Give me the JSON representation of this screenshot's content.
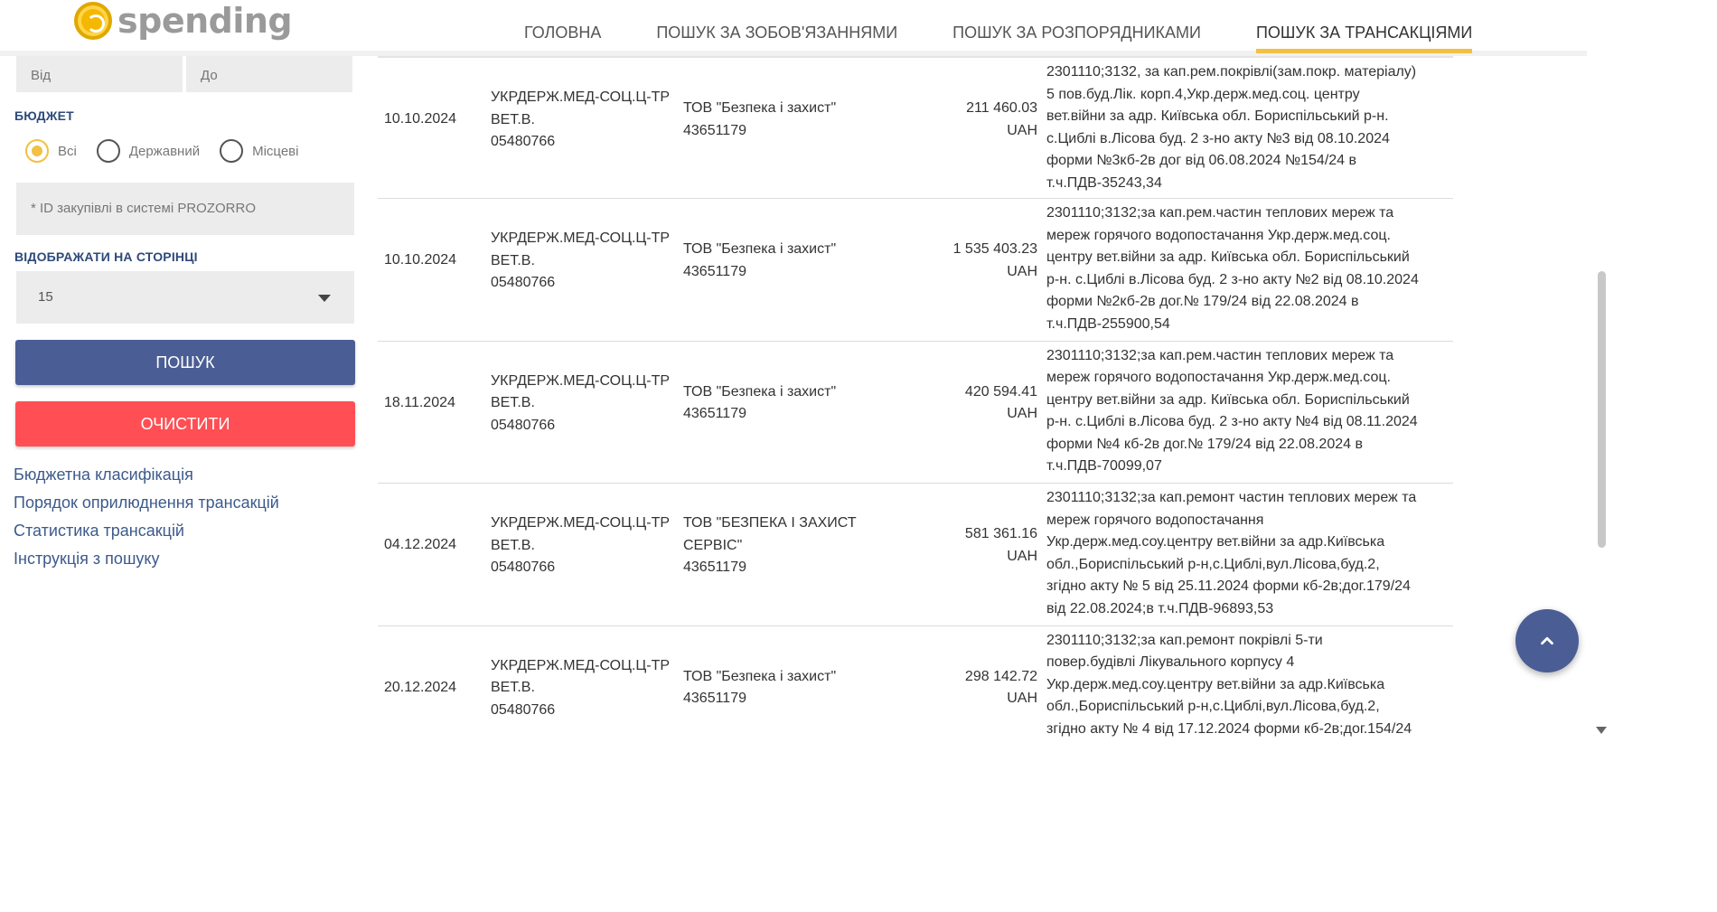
{
  "header": {
    "logo_text": "spending",
    "nav": [
      {
        "label": "ГОЛОВНА",
        "active": false
      },
      {
        "label": "ПОШУК ЗА ЗОБОВ'ЯЗАННЯМИ",
        "active": false
      },
      {
        "label": "ПОШУК ЗА РОЗПОРЯДНИКАМИ",
        "active": false
      },
      {
        "label": "ПОШУК ЗА ТРАНСАКЦІЯМИ",
        "active": true
      }
    ]
  },
  "sidebar": {
    "date_from_placeholder": "Від",
    "date_to_placeholder": "До",
    "budget_heading": "БЮДЖЕТ",
    "budget_options": [
      {
        "label": "Всі",
        "selected": true
      },
      {
        "label": "Державний",
        "selected": false
      },
      {
        "label": "Місцеві",
        "selected": false
      }
    ],
    "prozorro_placeholder": "* ID закупівлі в системі PROZORRO",
    "per_page_heading": "ВІДОБРАЖАТИ НА СТОРІНЦІ",
    "per_page_value": "15",
    "search_button": "ПОШУК",
    "clear_button": "ОЧИСТИТИ",
    "links": [
      "Бюджетна класифікація",
      "Порядок оприлюднення трансакцій",
      "Статистика трансакцій",
      "Інструкція з пошуку"
    ]
  },
  "rows": [
    {
      "date": "10.10.2024",
      "payer": [
        "УКРДЕРЖ.МЕД-СОЦ.Ц-ТР",
        "ВЕТ.В.",
        "05480766"
      ],
      "receiver": [
        "ТОВ \"Безпека і захист\"",
        "43651179"
      ],
      "amount": "211 460.03",
      "currency": "UAH",
      "description": [
        "2301110;3132, за кап.рем.покрівлі(зам.покр. матеріалу)",
        "5 пов.буд.Лік. корп.4,Укр.держ.мед.соц. центру",
        "вет.війни за адр. Київська обл. Бориспільський р-н.",
        "с.Циблі в.Лісова буд. 2 з-но акту №3 від 08.10.2024",
        "форми №3кб-2в дог від 06.08.2024 №154/24 в",
        "т.ч.ПДВ-35243,34"
      ]
    },
    {
      "date": "10.10.2024",
      "payer": [
        "УКРДЕРЖ.МЕД-СОЦ.Ц-ТР",
        "ВЕТ.В.",
        "05480766"
      ],
      "receiver": [
        "ТОВ \"Безпека і захист\"",
        "43651179"
      ],
      "amount": "1 535 403.23",
      "currency": "UAH",
      "description": [
        "2301110;3132;за кап.рем.частин теплових мереж та",
        "мереж горячого водопостачання Укр.держ.мед.соц.",
        "центру вет.війни за адр. Київська обл. Бориспільський",
        "р-н. с.Циблі в.Лісова буд. 2 з-но акту №2 від 08.10.2024",
        "форми №2кб-2в дог.№ 179/24 від 22.08.2024 в",
        "т.ч.ПДВ-255900,54"
      ]
    },
    {
      "date": "18.11.2024",
      "payer": [
        "УКРДЕРЖ.МЕД-СОЦ.Ц-ТР",
        "ВЕТ.В.",
        "05480766"
      ],
      "receiver": [
        "ТОВ \"Безпека і захист\"",
        "43651179"
      ],
      "amount": "420 594.41",
      "currency": "UAH",
      "description": [
        "2301110;3132;за кап.рем.частин теплових мереж та",
        "мереж горячого водопостачання Укр.держ.мед.соц.",
        "центру вет.війни за адр. Київська обл. Бориспільський",
        "р-н. с.Циблі в.Лісова буд. 2 з-но акту №4 від 08.11.2024",
        "форми №4 кб-2в дог.№ 179/24 від 22.08.2024 в",
        "т.ч.ПДВ-70099,07"
      ]
    },
    {
      "date": "04.12.2024",
      "payer": [
        "УКРДЕРЖ.МЕД-СОЦ.Ц-ТР",
        "ВЕТ.В.",
        "05480766"
      ],
      "receiver": [
        "ТОВ \"БЕЗПЕКА І ЗАХИСТ",
        "СЕРВІС\"",
        "43651179"
      ],
      "amount": "581 361.16",
      "currency": "UAH",
      "description": [
        "2301110;3132;за кап.ремонт частин теплових мереж та",
        "мереж горячого водопостачання",
        "Укр.держ.мед.соу.центру вет.війни за адр.Київська",
        "обл.,Бориспільський р-н,с.Циблі,вул.Лісова,буд.2,",
        "згідно акту № 5 від 25.11.2024 форми кб-2в;дог.179/24",
        "від 22.08.2024;в т.ч.ПДВ-96893,53"
      ]
    },
    {
      "date": "20.12.2024",
      "payer": [
        "УКРДЕРЖ.МЕД-СОЦ.Ц-ТР",
        "ВЕТ.В.",
        "05480766"
      ],
      "receiver": [
        "ТОВ \"Безпека і захист\"",
        "43651179"
      ],
      "amount": "298 142.72",
      "currency": "UAH",
      "description": [
        "2301110;3132;за кап.ремонт покрівлі 5-ти",
        "повер.будівлі Лікувального корпусу 4",
        "Укр.держ.мед.соу.центру вет.війни за адр.Київська",
        "обл.,Бориспільський р-н,с.Циблі,вул.Лісова,буд.2,",
        "згідно акту № 4 від 17.12.2024 форми кб-2в;дог.154/24"
      ]
    }
  ],
  "colors": {
    "accent": "#f2c043",
    "primary_button": "#4a5d94",
    "danger_button": "#ff4f54",
    "link": "#3c5a8c"
  },
  "icons": {
    "back_to_top": "chevron-up-icon",
    "select_caret": "caret-down-icon"
  }
}
